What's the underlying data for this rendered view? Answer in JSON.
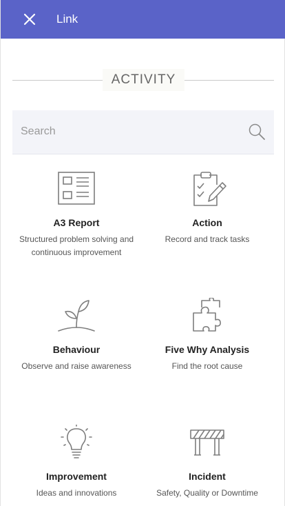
{
  "header": {
    "title": "Link",
    "background_color": "#5a63c8",
    "close_icon": "close-icon"
  },
  "section": {
    "heading": "ACTIVITY"
  },
  "search": {
    "placeholder": "Search",
    "value": "",
    "icon": "search-icon"
  },
  "activities": [
    {
      "name": "A3 Report",
      "description": "Structured problem solving and continuous improvement",
      "icon": "report-icon"
    },
    {
      "name": "Action",
      "description": "Record and track tasks",
      "icon": "clipboard-check-icon"
    },
    {
      "name": "Behaviour",
      "description": "Observe and raise awareness",
      "icon": "sprout-icon"
    },
    {
      "name": "Five Why Analysis",
      "description": "Find the root cause",
      "icon": "puzzle-icon"
    },
    {
      "name": "Improvement",
      "description": "Ideas and innovations",
      "icon": "lightbulb-icon"
    },
    {
      "name": "Incident",
      "description": "Safety, Quality or Downtime",
      "icon": "barrier-icon"
    }
  ]
}
